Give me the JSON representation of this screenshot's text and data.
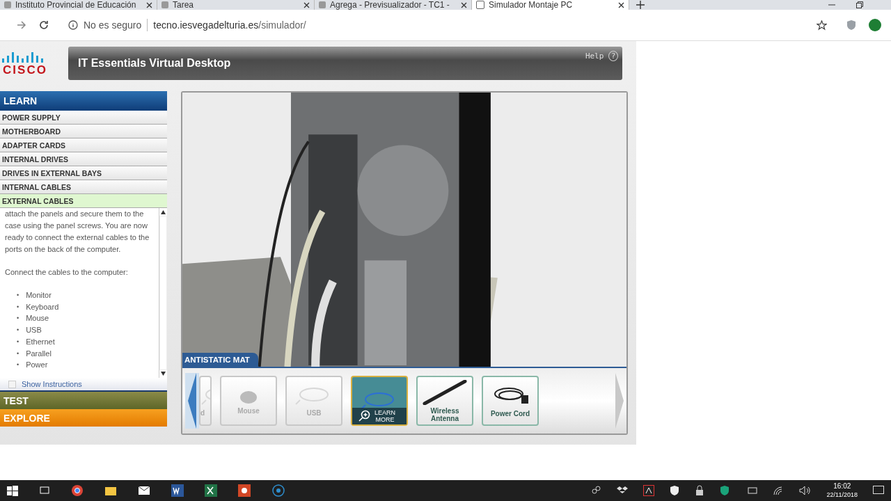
{
  "browser": {
    "tabs": [
      {
        "title": "Instituto Provincial de Educación",
        "selected": false
      },
      {
        "title": "Tarea",
        "selected": false
      },
      {
        "title": "Agrega - Previsualizador - TC1 -",
        "selected": false
      },
      {
        "title": "Simulador Montaje PC",
        "selected": true
      }
    ],
    "security": "No es seguro",
    "url_host": "tecno.iesvegadelturia.es",
    "url_path": "/simulador/"
  },
  "app": {
    "logo": "CISCO",
    "title": "IT Essentials Virtual Desktop",
    "help": "Help",
    "help_icon": "?"
  },
  "sidebar": {
    "learn": "LEARN",
    "items": [
      {
        "label": "POWER SUPPLY",
        "selected": false
      },
      {
        "label": "MOTHERBOARD",
        "selected": false
      },
      {
        "label": "ADAPTER CARDS",
        "selected": false
      },
      {
        "label": "INTERNAL DRIVES",
        "selected": false
      },
      {
        "label": "DRIVES IN EXTERNAL BAYS",
        "selected": false
      },
      {
        "label": "INTERNAL CABLES",
        "selected": false
      },
      {
        "label": "EXTERNAL CABLES",
        "selected": true
      }
    ],
    "paragraphs": [
      "attach the panels and secure them to the case using the panel screws. You are now ready to connect the external cables to the ports on the back of the computer.",
      "Connect the cables to the computer:"
    ],
    "bullets": [
      "Monitor",
      "Keyboard",
      "Mouse",
      "USB",
      "Ethernet",
      "Parallel",
      "Power"
    ],
    "bullet": "•",
    "show_instructions": {
      "label": "Show Instructions",
      "checked": false
    },
    "test": "TEST",
    "explore": "EXPLORE"
  },
  "scene": {
    "label": "ANTISTATIC MAT"
  },
  "tray": {
    "items": [
      {
        "kind": "cable",
        "label": "d",
        "disabled": true,
        "selected": false
      },
      {
        "kind": "mouse",
        "label": "Mouse",
        "disabled": true,
        "selected": false
      },
      {
        "kind": "cable",
        "label": "USB",
        "disabled": true,
        "selected": false
      },
      {
        "kind": "cable",
        "disabled": false,
        "selected": true,
        "overlay": [
          "LEARN",
          "MORE"
        ]
      },
      {
        "kind": "antenna",
        "label": "Wireless Antenna",
        "disabled": false,
        "selected": false
      },
      {
        "kind": "cord",
        "label": "Power Cord",
        "disabled": false,
        "selected": false
      }
    ]
  },
  "taskbar": {
    "time": "16:02",
    "date": "22/11/2018"
  }
}
